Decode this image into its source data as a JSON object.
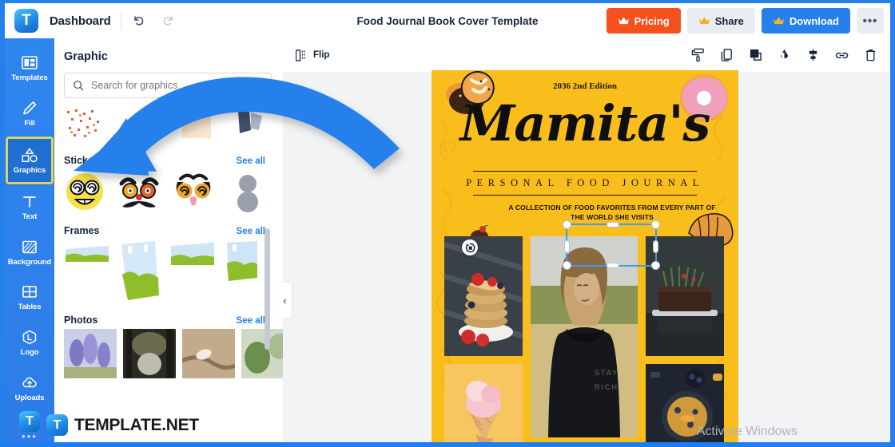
{
  "header": {
    "logo_letter": "T",
    "dashboard_label": "Dashboard",
    "undo_icon": "undo-icon",
    "redo_icon": "redo-icon",
    "document_title": "Food Journal Book Cover Template",
    "pricing_label": "Pricing",
    "share_label": "Share",
    "download_label": "Download",
    "more_label": "•••",
    "pricing_color": "#f4511e",
    "download_color": "#2680eb",
    "share_color": "#e9edf2"
  },
  "sidebar": {
    "accent_color": "#2f86ef",
    "active_outline_color": "#d8d467",
    "items": [
      {
        "label": "Templates",
        "icon": "templates-icon",
        "active": false
      },
      {
        "label": "Fill",
        "icon": "pencil-fill-icon",
        "active": false
      },
      {
        "label": "Graphics",
        "icon": "shapes-icon",
        "active": true
      },
      {
        "label": "Text",
        "icon": "text-icon",
        "active": false
      },
      {
        "label": "Background",
        "icon": "background-icon",
        "active": false
      },
      {
        "label": "Tables",
        "icon": "tables-icon",
        "active": false
      },
      {
        "label": "Logo",
        "icon": "logo-icon",
        "active": false
      },
      {
        "label": "Uploads",
        "icon": "upload-cloud-icon",
        "active": false
      }
    ],
    "footer_logo_letter": "T",
    "footer_dots": "•••"
  },
  "panel": {
    "title": "Graphic",
    "search_placeholder": "Search for graphics",
    "search_value": "",
    "search_icon": "search-icon",
    "collapse_icon": "‹",
    "next_icon": "›",
    "sections": [
      {
        "name": "Stickers",
        "see_all": "See all"
      },
      {
        "name": "Frames",
        "see_all": "See all"
      },
      {
        "name": "Photos",
        "see_all": "See all"
      }
    ]
  },
  "canvas_toolbar": {
    "flip_label": "Flip",
    "flip_icon": "flip-icon",
    "tools": [
      {
        "name": "paint-roller-icon"
      },
      {
        "name": "duplicate-icon"
      },
      {
        "name": "layers-position-icon"
      },
      {
        "name": "opacity-droplet-icon"
      },
      {
        "name": "align-icon"
      },
      {
        "name": "link-icon"
      },
      {
        "name": "delete-trash-icon"
      }
    ]
  },
  "cover": {
    "background_color": "#f9bd1c",
    "edition": "2036 2nd Edition",
    "brand": "Mamita's",
    "subtitle": "PERSONAL FOOD JOURNAL",
    "description": "A COLLECTION OF FOOD FAVORITES FROM EVERY PART OF THE WORLD SHE VISITS",
    "crop_icon": "crop-rotate-icon",
    "photos": [
      {
        "name": "pancake-stack-photo"
      },
      {
        "name": "woman-portrait-photo"
      },
      {
        "name": "chocolate-cake-photo"
      },
      {
        "name": "ice-cream-cone-photo"
      },
      {
        "name": "skillet-blueberry-photo"
      }
    ],
    "decorations": [
      {
        "name": "pretzel-sticker"
      },
      {
        "name": "cupcake-sticker"
      },
      {
        "name": "donut-sticker"
      },
      {
        "name": "croissant-sticker"
      },
      {
        "name": "waffle-sundae-sticker"
      }
    ]
  },
  "overlays": {
    "arrow_color": "#2680eb",
    "watermark_logo_letter": "T",
    "watermark_text": "TEMPLATE.NET",
    "activate_windows": "Activate Windows"
  }
}
